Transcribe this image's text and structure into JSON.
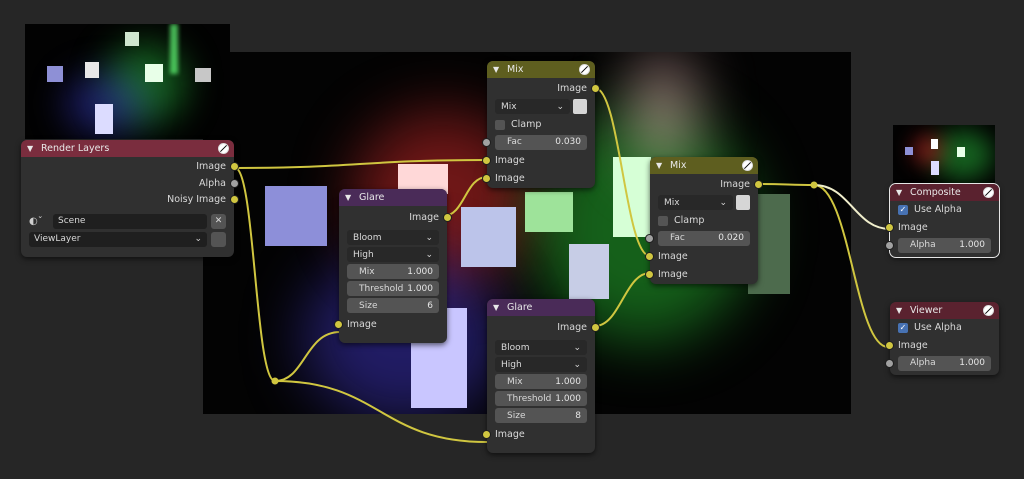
{
  "colors": {
    "canvas": "#262626",
    "socket_image": "#d0c640",
    "socket_value": "#a1a1a1",
    "wire": "#d0c640"
  },
  "render_layers": {
    "title": "Render Layers",
    "outputs": [
      "Image",
      "Alpha",
      "Noisy Image"
    ],
    "scene": "Scene",
    "view_layer": "ViewLayer",
    "icons": [
      "chevron-down-icon",
      "scene-icon",
      "close-icon",
      "render-icon"
    ]
  },
  "glare1": {
    "title": "Glare",
    "output": "Image",
    "type": "Bloom",
    "quality": "High",
    "mix_label": "Mix",
    "mix_value": "1.000",
    "threshold_label": "Threshold",
    "threshold_value": "1.000",
    "size_label": "Size",
    "size_value": "6",
    "input": "Image"
  },
  "glare2": {
    "title": "Glare",
    "output": "Image",
    "type": "Bloom",
    "quality": "High",
    "mix_label": "Mix",
    "mix_value": "1.000",
    "threshold_label": "Threshold",
    "threshold_value": "1.000",
    "size_label": "Size",
    "size_value": "8",
    "input": "Image"
  },
  "mix1": {
    "title": "Mix",
    "output": "Image",
    "blend": "Mix",
    "clamp": "Clamp",
    "fac_label": "Fac",
    "fac_value": "0.030",
    "input1": "Image",
    "input2": "Image"
  },
  "mix2": {
    "title": "Mix",
    "output": "Image",
    "blend": "Mix",
    "clamp": "Clamp",
    "fac_label": "Fac",
    "fac_value": "0.020",
    "input1": "Image",
    "input2": "Image"
  },
  "composite": {
    "title": "Composite",
    "use_alpha": "Use Alpha",
    "input": "Image",
    "alpha_label": "Alpha",
    "alpha_value": "1.000"
  },
  "viewer": {
    "title": "Viewer",
    "use_alpha": "Use Alpha",
    "input": "Image",
    "alpha_label": "Alpha",
    "alpha_value": "1.000"
  }
}
